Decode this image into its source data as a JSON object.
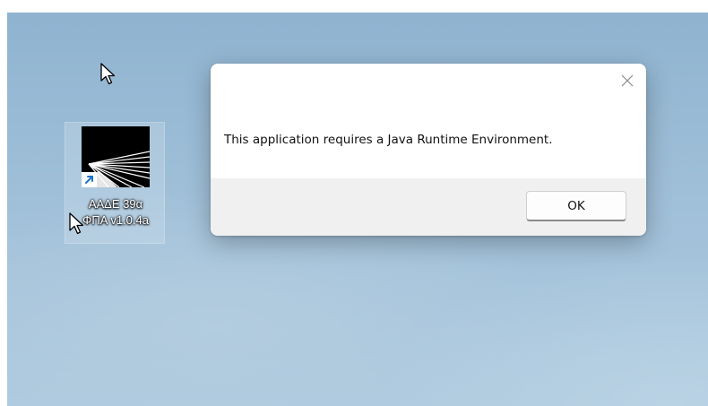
{
  "desktop": {
    "shortcut": {
      "label_line1": "ΑΑΔΕ 39α",
      "label_line2": "ΦΠΑ v1.0.4a",
      "icon": "app-logo-icon",
      "overlay_icon": "shortcut-arrow-icon"
    }
  },
  "dialog": {
    "message": "This application requires a Java Runtime Environment.",
    "close_icon": "close-icon",
    "ok_label": "OK"
  },
  "colors": {
    "desktop_bg": "#9fbfd8",
    "dialog_bg": "#ffffff",
    "footer_bg": "#f0f0f0",
    "shortcut_arrow": "#1e73c8"
  }
}
